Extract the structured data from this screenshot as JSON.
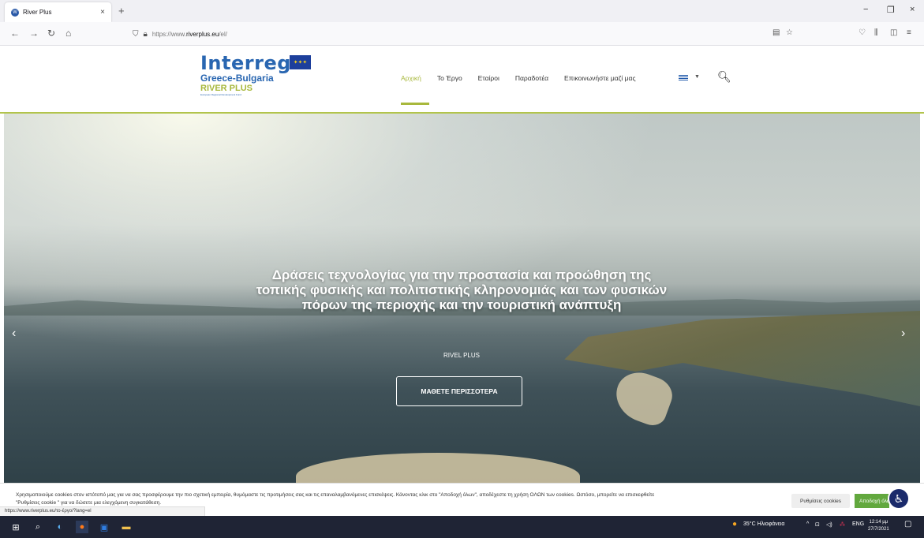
{
  "browser": {
    "tab_title": "River Plus",
    "tab_close": "×",
    "new_tab": "+",
    "url_prefix": "https://www.",
    "url_domain": "riverplus.eu",
    "url_path": "/el/",
    "win_minimize": "−",
    "win_restore": "❐",
    "win_close": "×"
  },
  "logo": {
    "line1": "Interreg",
    "line2": "Greece-Bulgaria",
    "line3": "RIVER PLUS",
    "line4": "European Regional Development Fund",
    "flag_stars": "✦✦✦"
  },
  "menu": {
    "items": [
      "Αρχική",
      "Το Έργο",
      "Εταίροι",
      "Παραδοτέα",
      "Επικοινωνήστε μαζί μας"
    ],
    "active_index": 0
  },
  "hero": {
    "title": "Δράσεις τεχνολογίας για την προστασία και προώθηση της τοπικής φυσικής και πολιτιστικής κληρονομιάς και των φυσικών πόρων της περιοχής και την τουριστική ανάπτυξη",
    "subtitle": "RIVEL PLUS",
    "button": "ΜΑΘΕΤΕ ΠΕΡΙΣΣΟΤΕΡΑ",
    "prev": "‹",
    "next": "›"
  },
  "cookie": {
    "text": "Χρησιμοποιούμε cookies στον ιστότοπό μας για να σας προσφέρουμε την πιο σχετική εμπειρία, θυμόμαστε τις προτιμήσεις σας και τις επαναλαμβανόμενες επισκέψεις. Κάνοντας κλικ στο \"Αποδοχή όλων\", αποδέχεστε τη χρήση ΟΛΩΝ των cookies. Ωστόσο, μπορείτε να επισκεφθείτε \"Ρυθμίσεις cookie \" για να δώσετε μια ελεγχόμενη συγκατάθεση.",
    "settings": "Ρυθμίσεις cookies",
    "accept": "Αποδοχή όλων"
  },
  "status_url": "https://www.riverplus.eu/το-έργο/?lang=el",
  "taskbar": {
    "weather": "35°C Ηλιοφάνεια",
    "lang": "ENG",
    "time": "12:14 μμ",
    "date": "27/7/2021"
  }
}
